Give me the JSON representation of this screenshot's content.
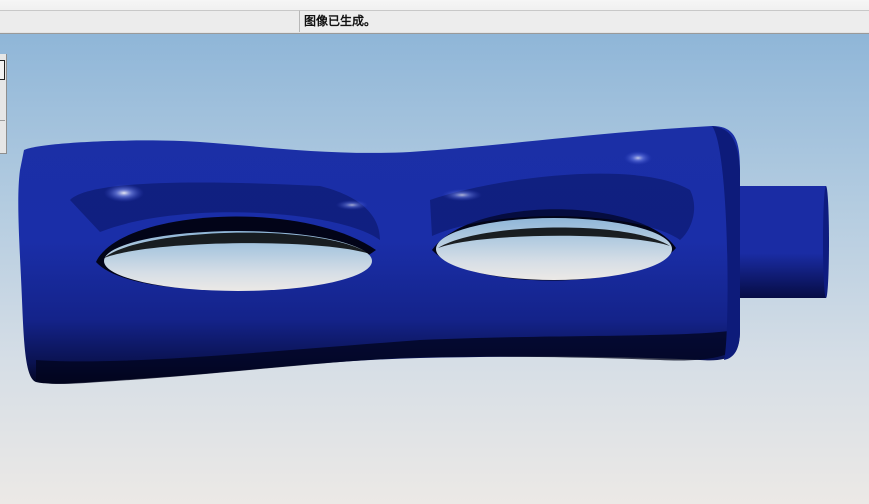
{
  "status_bar": {
    "message": "图像已生成。"
  },
  "colors": {
    "model_body": "#1830a8",
    "model_shadow": "#050a40",
    "background_top": "#8fb6d8",
    "background_bottom": "#ece9e6"
  }
}
